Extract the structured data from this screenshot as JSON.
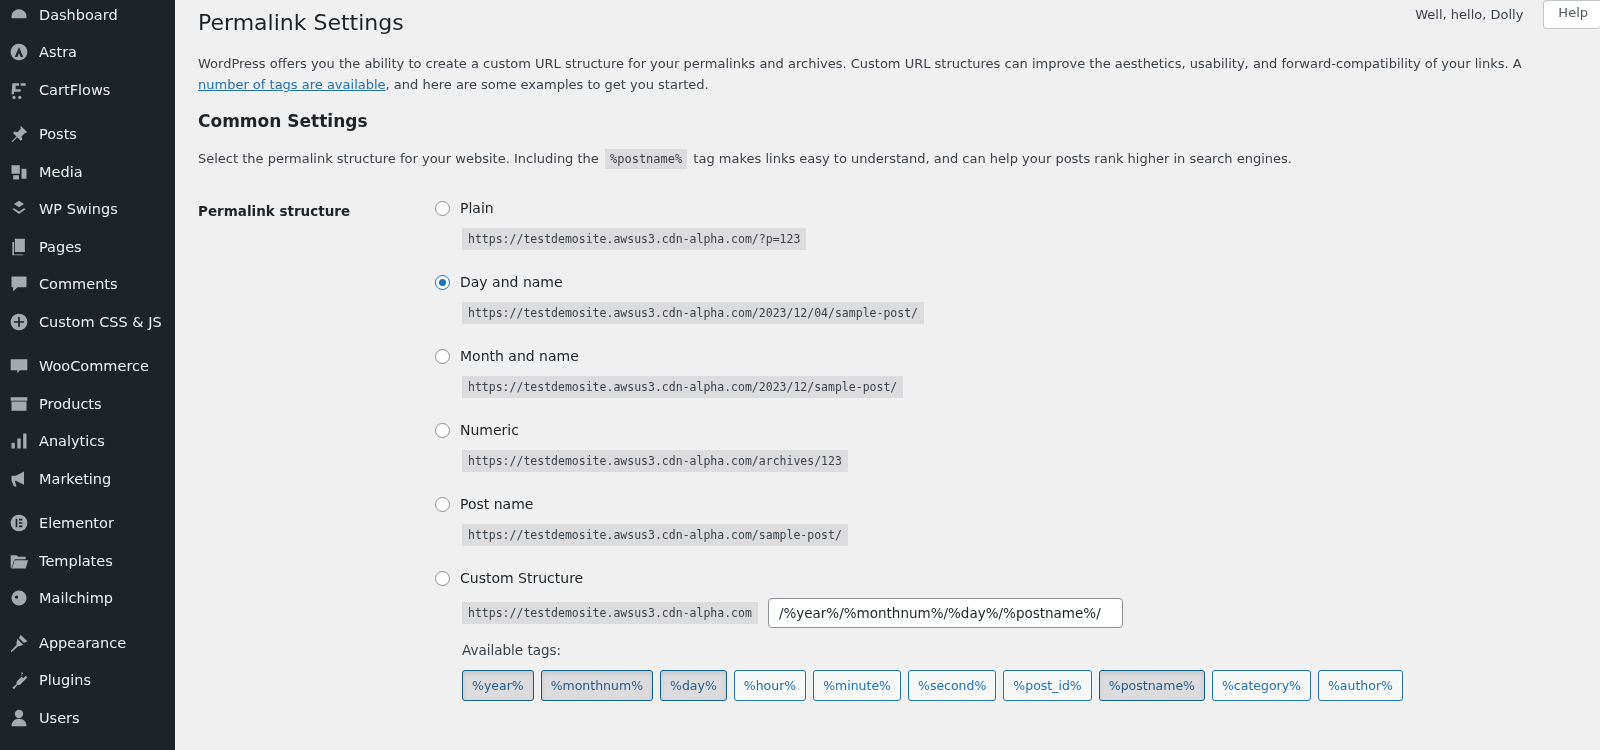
{
  "sidebar": {
    "groups": [
      {
        "items": [
          {
            "label": "Dashboard"
          },
          {
            "label": "Astra"
          },
          {
            "label": "CartFlows"
          }
        ]
      },
      {
        "items": [
          {
            "label": "Posts"
          },
          {
            "label": "Media"
          },
          {
            "label": "WP Swings"
          },
          {
            "label": "Pages"
          },
          {
            "label": "Comments"
          },
          {
            "label": "Custom CSS & JS"
          }
        ]
      },
      {
        "items": [
          {
            "label": "WooCommerce"
          },
          {
            "label": "Products"
          },
          {
            "label": "Analytics"
          },
          {
            "label": "Marketing"
          }
        ]
      },
      {
        "items": [
          {
            "label": "Elementor"
          },
          {
            "label": "Templates"
          },
          {
            "label": "Mailchimp"
          }
        ]
      },
      {
        "items": [
          {
            "label": "Appearance"
          },
          {
            "label": "Plugins"
          },
          {
            "label": "Users"
          }
        ]
      }
    ]
  },
  "top_bar": {
    "greeting": "Well, hello, Dolly",
    "help_button": "Help"
  },
  "page": {
    "title": "Permalink Settings",
    "intro": "WordPress offers you the ability to create a custom URL structure for your permalinks and archives. Custom URL structures can improve the aesthetics, usability, and forward-compatibility of your links. A ",
    "intro_link": "number of tags are available",
    "intro_end": ", and here are some examples to get you started.",
    "section_title": "Common Settings",
    "section_text_before": "Select the permalink structure for your website. Including the ",
    "section_code": "%postname%",
    "section_text_after": " tag makes links easy to understand, and can help your posts rank higher in search engines.",
    "field_label": "Permalink structure",
    "options": [
      {
        "label": "Plain",
        "example": "https://testdemosite.awsus3.cdn-alpha.com/?p=123",
        "selected": false
      },
      {
        "label": "Day and name",
        "example": "https://testdemosite.awsus3.cdn-alpha.com/2023/12/04/sample-post/",
        "selected": true
      },
      {
        "label": "Month and name",
        "example": "https://testdemosite.awsus3.cdn-alpha.com/2023/12/sample-post/",
        "selected": false
      },
      {
        "label": "Numeric",
        "example": "https://testdemosite.awsus3.cdn-alpha.com/archives/123",
        "selected": false
      },
      {
        "label": "Post name",
        "example": "https://testdemosite.awsus3.cdn-alpha.com/sample-post/",
        "selected": false
      },
      {
        "label": "Custom Structure",
        "example": "https://testdemosite.awsus3.cdn-alpha.com",
        "selected": false
      }
    ],
    "custom_value": "/%year%/%monthnum%/%day%/%postname%/",
    "tags_label": "Available tags:",
    "tags": [
      {
        "label": "%year%",
        "selected": true
      },
      {
        "label": "%monthnum%",
        "selected": true
      },
      {
        "label": "%day%",
        "selected": true
      },
      {
        "label": "%hour%",
        "selected": false
      },
      {
        "label": "%minute%",
        "selected": false
      },
      {
        "label": "%second%",
        "selected": false
      },
      {
        "label": "%post_id%",
        "selected": false
      },
      {
        "label": "%postname%",
        "selected": true
      },
      {
        "label": "%category%",
        "selected": false
      },
      {
        "label": "%author%",
        "selected": false
      }
    ]
  }
}
